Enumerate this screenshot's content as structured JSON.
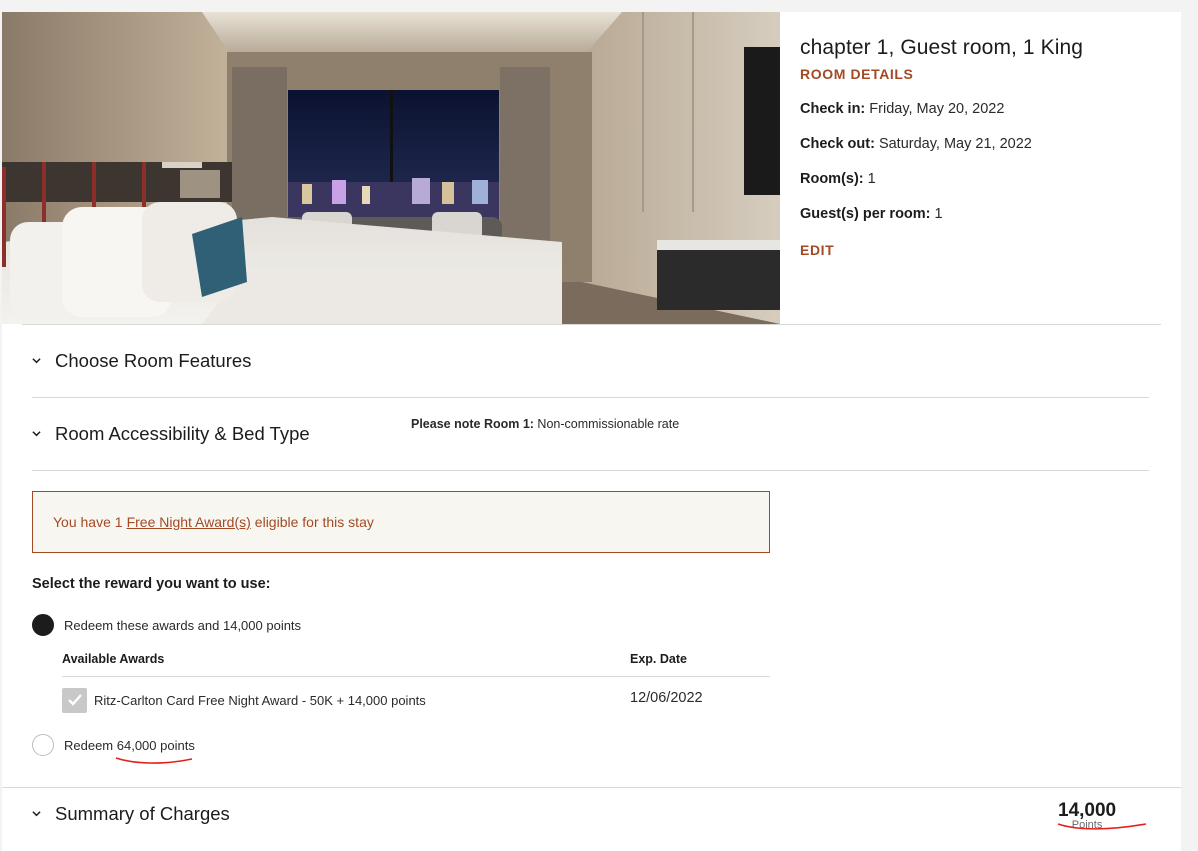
{
  "room": {
    "title": "chapter 1, Guest room, 1 King",
    "details_link": "ROOM DETAILS",
    "check_in_label": "Check in:",
    "check_in_value": " Friday, May 20, 2022",
    "check_out_label": "Check out:",
    "check_out_value": " Saturday, May 21, 2022",
    "rooms_label": "Room(s):",
    "rooms_value": " 1",
    "guests_label": "Guest(s) per room:",
    "guests_value": " 1",
    "edit_link": "EDIT"
  },
  "sections": {
    "room_features": "Choose Room Features",
    "accessibility": "Room Accessibility & Bed Type",
    "summary": "Summary of Charges"
  },
  "note": {
    "label": "Please note Room 1:",
    "value": " Non-commissionable rate"
  },
  "award_banner": {
    "prefix": "You have 1",
    "link": "Free Night Award(s)",
    "suffix": "eligible for this stay"
  },
  "reward_selection": {
    "label": "Select the reward you want to use:",
    "option_awards": "Redeem these awards and 14,000 points",
    "option_points": "Redeem 64,000 points"
  },
  "awards_table": {
    "col_awards": "Available Awards",
    "col_exp": "Exp. Date",
    "rows": [
      {
        "name": "Ritz-Carlton Card Free Night Award - 50K + 14,000 points",
        "exp": "12/06/2022",
        "checked": true
      }
    ]
  },
  "summary": {
    "points": "14,000",
    "unit": "Points"
  },
  "colors": {
    "accent": "#a34a25",
    "banner_bg": "#f8f6f1",
    "annotation_red": "#e3201b"
  },
  "icons": {
    "chevron": "chevron-down-icon",
    "check": "checkmark-icon"
  }
}
